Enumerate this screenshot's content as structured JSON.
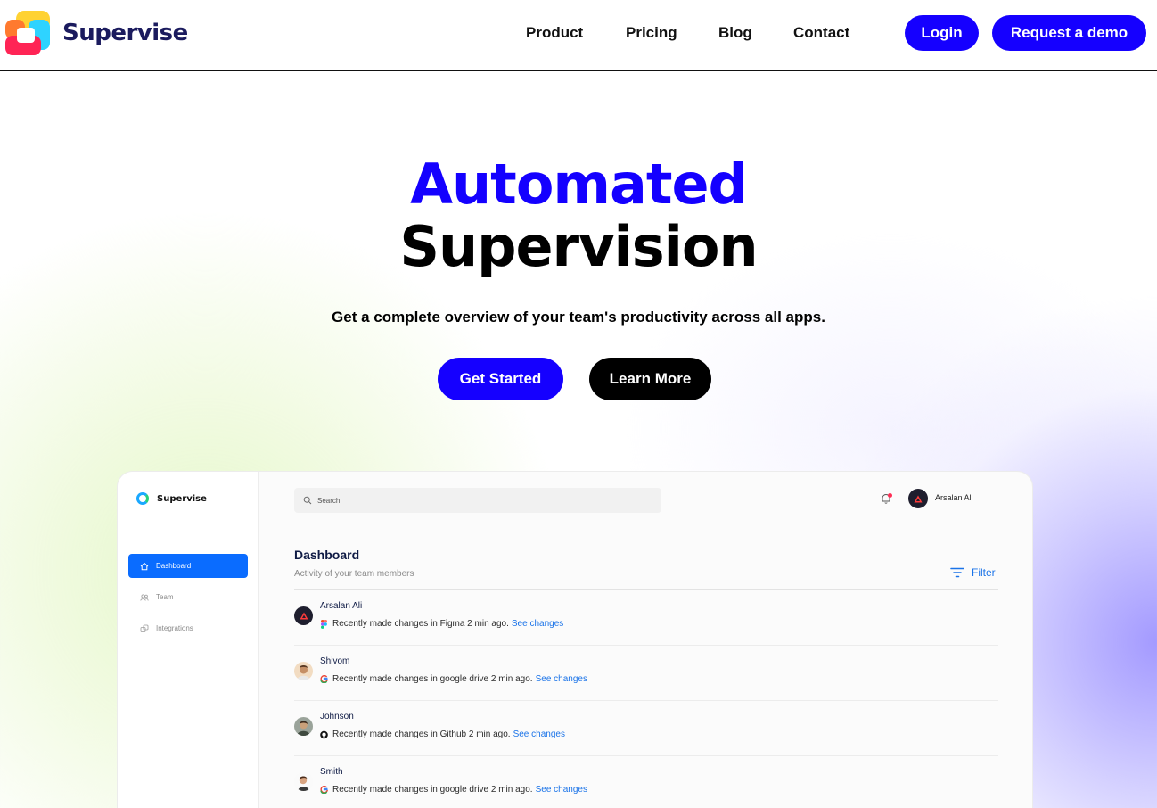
{
  "brand": {
    "name": "Supervise"
  },
  "nav": {
    "links": [
      "Product",
      "Pricing",
      "Blog",
      "Contact"
    ],
    "login": "Login",
    "demo": "Request a demo"
  },
  "hero": {
    "title_line1": "Automated",
    "title_line2": "Supervision",
    "subtitle": "Get a complete overview of your team's productivity across all apps.",
    "primary_cta": "Get Started",
    "secondary_cta": "Learn More"
  },
  "colors": {
    "accent": "#1400ff",
    "mock_active": "#0a6cff",
    "link_blue": "#1a73e8"
  },
  "app": {
    "name": "Supervise",
    "sidebar": [
      {
        "label": "Dashboard",
        "icon": "home-icon",
        "active": true
      },
      {
        "label": "Team",
        "icon": "team-icon",
        "active": false
      },
      {
        "label": "Integrations",
        "icon": "integrations-icon",
        "active": false
      }
    ],
    "search_placeholder": "Search",
    "user_name": "Arsalan Ali",
    "dashboard_title": "Dashboard",
    "dashboard_subtitle": "Activity of your team members",
    "filter_label": "Filter",
    "activities": [
      {
        "name": "Arsalan Ali",
        "app_icon": "figma-icon",
        "text": "Recently made changes in Figma 2 min ago.",
        "link": "See changes"
      },
      {
        "name": "Shivom",
        "app_icon": "google-icon",
        "text": "Recently made changes in google drive 2 min ago.",
        "link": "See changes"
      },
      {
        "name": "Johnson",
        "app_icon": "github-icon",
        "text": "Recently made changes in Github 2 min ago.",
        "link": "See changes"
      },
      {
        "name": "Smith",
        "app_icon": "google-icon",
        "text": "Recently made changes in google drive 2 min ago.",
        "link": "See changes"
      }
    ]
  }
}
